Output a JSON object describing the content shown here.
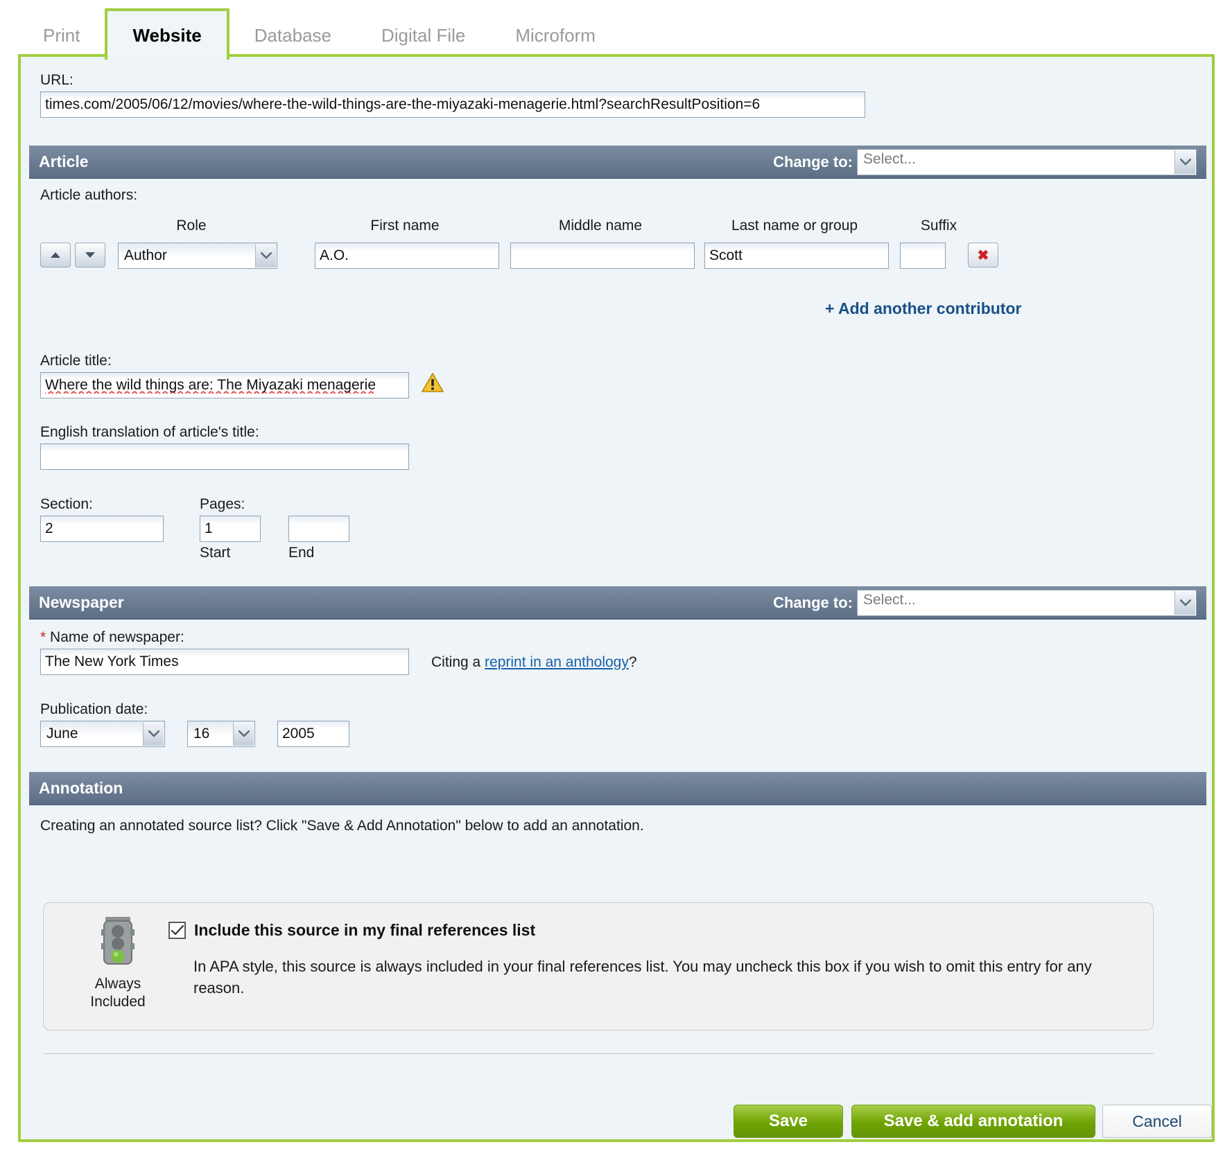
{
  "tabs": [
    {
      "label": "Print",
      "active": false
    },
    {
      "label": "Website",
      "active": true
    },
    {
      "label": "Database",
      "active": false
    },
    {
      "label": "Digital File",
      "active": false
    },
    {
      "label": "Microform",
      "active": false
    }
  ],
  "url_field": {
    "label": "URL:",
    "value": "times.com/2005/06/12/movies/where-the-wild-things-are-the-miyazaki-menagerie.html?searchResultPosition=6"
  },
  "article_section": {
    "title": "Article",
    "change_to_label": "Change to:",
    "change_to_value": "Select...",
    "authors_label": "Article authors:",
    "columns": {
      "role": "Role",
      "first_name": "First name",
      "middle_name": "Middle name",
      "last_name": "Last name or group",
      "suffix": "Suffix"
    },
    "contributors": [
      {
        "role": "Author",
        "first_name": "A.O.",
        "middle_name": "",
        "last_name": "Scott",
        "suffix": ""
      }
    ],
    "add_contributor_label": "+ Add another contributor",
    "article_title_label": "Article title:",
    "article_title_value": "Where the wild things are: The Miyazaki menagerie",
    "english_translation_label": "English translation of article's title:",
    "english_translation_value": "",
    "section_label": "Section:",
    "section_value": "2",
    "pages_label": "Pages:",
    "page_start_value": "1",
    "page_end_value": "",
    "page_start_caption": "Start",
    "page_end_caption": "End"
  },
  "newspaper_section": {
    "title": "Newspaper",
    "change_to_label": "Change to:",
    "change_to_value": "Select...",
    "required_mark": "*",
    "name_label": "Name of newspaper:",
    "name_value": "The New York Times",
    "reprint_prefix": "Citing a ",
    "reprint_link": "reprint in an anthology",
    "reprint_suffix": "?",
    "pub_date_label": "Publication date:",
    "pub_month": "June",
    "pub_day": "16",
    "pub_year": "2005"
  },
  "annotation_section": {
    "title": "Annotation",
    "hint": "Creating an annotated source list? Click \"Save & Add Annotation\" below to add an annotation."
  },
  "include_box": {
    "badge_line1": "Always",
    "badge_line2": "Included",
    "checkbox_checked": true,
    "checkbox_label": "Include this source in my final references list",
    "description": "In APA style, this source is always included in your final references list. You may uncheck this box if you wish to omit this entry for any reason."
  },
  "footer_buttons": {
    "save": "Save",
    "save_add_annotation": "Save & add annotation",
    "cancel": "Cancel"
  },
  "colors": {
    "accent_green": "#9fce3e",
    "header_bar": "#5c6e85",
    "panel_bg": "#eef4f7",
    "link_blue": "#1a5fa8",
    "required_red": "#cc2222"
  }
}
